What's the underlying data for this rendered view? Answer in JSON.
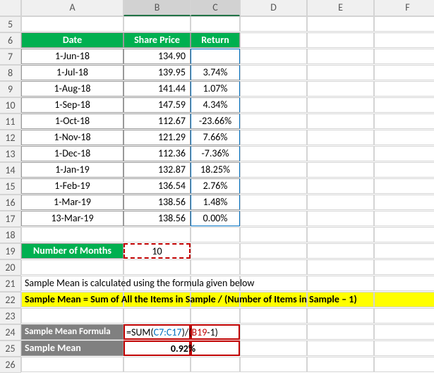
{
  "cols": [
    "A",
    "B",
    "C",
    "D",
    "E",
    "F"
  ],
  "rows": [
    "5",
    "6",
    "7",
    "8",
    "9",
    "10",
    "11",
    "12",
    "13",
    "14",
    "15",
    "16",
    "17",
    "18",
    "19",
    "20",
    "21",
    "22",
    "23",
    "24",
    "25",
    "26"
  ],
  "headers": {
    "date": "Date",
    "price": "Share Price",
    "ret": "Return"
  },
  "data": [
    {
      "date": "1-Jun-18",
      "price": "134.90",
      "ret": ""
    },
    {
      "date": "1-Jul-18",
      "price": "139.95",
      "ret": "3.74%"
    },
    {
      "date": "1-Aug-18",
      "price": "141.44",
      "ret": "1.07%"
    },
    {
      "date": "1-Sep-18",
      "price": "147.59",
      "ret": "4.34%"
    },
    {
      "date": "1-Oct-18",
      "price": "112.67",
      "ret": "-23.66%"
    },
    {
      "date": "1-Nov-18",
      "price": "121.29",
      "ret": "7.66%"
    },
    {
      "date": "1-Dec-18",
      "price": "112.36",
      "ret": "-7.36%"
    },
    {
      "date": "1-Jan-19",
      "price": "132.87",
      "ret": "18.25%"
    },
    {
      "date": "1-Feb-19",
      "price": "136.54",
      "ret": "2.76%"
    },
    {
      "date": "1-Mar-19",
      "price": "138.56",
      "ret": "1.48%"
    },
    {
      "date": "13-Mar-19",
      "price": "138.56",
      "ret": "0.00%"
    }
  ],
  "months_label": "Number of Months",
  "months_value": "10",
  "note": "Sample Mean is calculated using the formula given below",
  "formula_text": "Sample Mean = Sum of All the Items in Sample / (Number of Items in Sample – 1)",
  "smf_label": "Sample Mean Formula",
  "sm_label": "Sample Mean",
  "formula": {
    "p1": "=SUM(",
    "p2": "C7:C17",
    "p3": ")/(",
    "p4": "B19",
    "p5": "-1)"
  },
  "sm_value": "0.92%"
}
